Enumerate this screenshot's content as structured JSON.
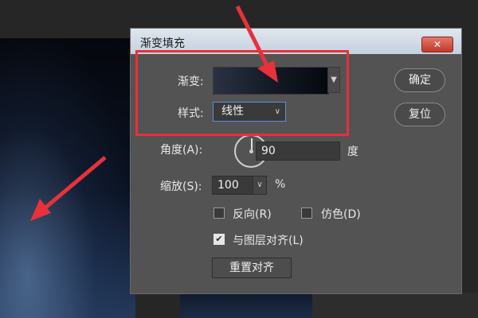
{
  "dialog": {
    "title": "渐变填充",
    "close_label": "✕"
  },
  "gradient": {
    "label": "渐变:"
  },
  "style": {
    "label": "样式:",
    "value": "线性"
  },
  "angle": {
    "label": "角度(A):",
    "value": "90",
    "unit": "度"
  },
  "scale": {
    "label": "缩放(S):",
    "value": "100",
    "unit": "%"
  },
  "checkboxes": [
    {
      "label": "反向(R)",
      "checked": false
    },
    {
      "label": "仿色(D)",
      "checked": false
    },
    {
      "label": "与图层对齐(L)",
      "checked": true
    }
  ],
  "buttons": {
    "ok": "确定",
    "reset": "复位",
    "reset_align": "重置对齐"
  },
  "colors": {
    "annotation": "#e8313a",
    "focus": "#5b8fd8"
  }
}
